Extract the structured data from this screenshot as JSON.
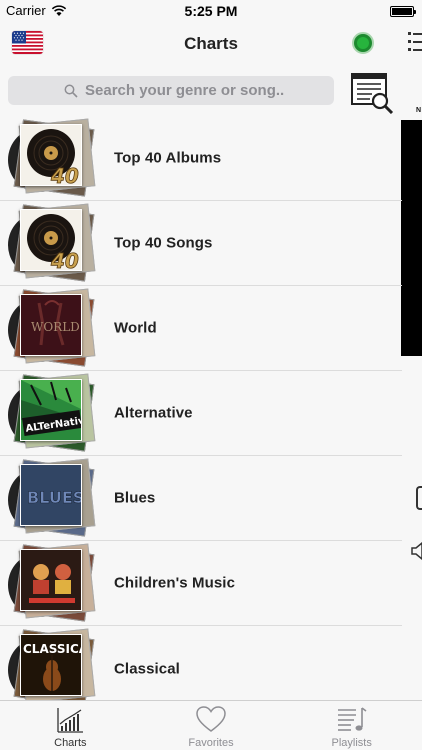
{
  "status_bar": {
    "carrier": "Carrier",
    "time": "5:25 PM"
  },
  "nav": {
    "title": "Charts"
  },
  "search": {
    "placeholder": "Search your genre or song.."
  },
  "side_panel": {
    "label": "N"
  },
  "charts": [
    {
      "label": "Top 40 Albums",
      "art": "top40"
    },
    {
      "label": "Top 40 Songs",
      "art": "top40"
    },
    {
      "label": "World",
      "art": "world"
    },
    {
      "label": "Alternative",
      "art": "alternative"
    },
    {
      "label": "Blues",
      "art": "blues"
    },
    {
      "label": "Children's Music",
      "art": "childrens"
    },
    {
      "label": "Classical",
      "art": "classical"
    }
  ],
  "tabs": [
    {
      "label": "Charts",
      "icon": "chart-icon",
      "active": true
    },
    {
      "label": "Favorites",
      "icon": "heart-icon",
      "active": false
    },
    {
      "label": "Playlists",
      "icon": "playlist-icon",
      "active": false
    }
  ],
  "colors": {
    "record_green": "#27b43d",
    "tab_inactive": "#8e8e93"
  }
}
